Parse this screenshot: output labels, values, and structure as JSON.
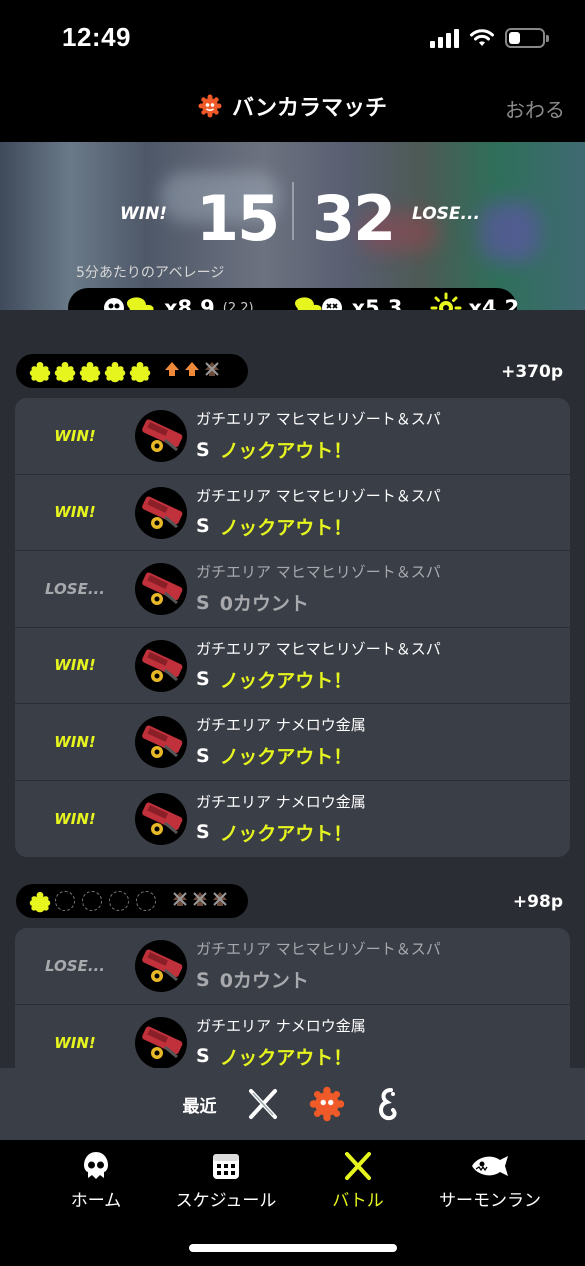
{
  "status": {
    "time": "12:49",
    "battery_level": 0.35
  },
  "header": {
    "title": "バンカラマッチ",
    "close_label": "おわる"
  },
  "summary": {
    "win_label": "WIN!",
    "win_count": "15",
    "lose_count": "32",
    "lose_label": "LOSE...",
    "average_label": "5分あたりのアベレージ",
    "kills": "x8.9",
    "assists": "(2.2)",
    "deaths": "x5.3",
    "specials": "x4.2"
  },
  "groups": [
    {
      "points": "+370p",
      "ink_filled": 5,
      "ink_empty": 0,
      "matches": [
        {
          "result": "WIN!",
          "stage": "ガチエリア マヒマヒリゾート＆スパ",
          "rank": "S",
          "outcome": "ノックアウト！"
        },
        {
          "result": "WIN!",
          "stage": "ガチエリア マヒマヒリゾート＆スパ",
          "rank": "S",
          "outcome": "ノックアウト！"
        },
        {
          "result": "LOSE...",
          "stage": "ガチエリア マヒマヒリゾート＆スパ",
          "rank": "S",
          "outcome": "0カウント"
        },
        {
          "result": "WIN!",
          "stage": "ガチエリア マヒマヒリゾート＆スパ",
          "rank": "S",
          "outcome": "ノックアウト！"
        },
        {
          "result": "WIN!",
          "stage": "ガチエリア ナメロウ金属",
          "rank": "S",
          "outcome": "ノックアウト！"
        },
        {
          "result": "WIN!",
          "stage": "ガチエリア ナメロウ金属",
          "rank": "S",
          "outcome": "ノックアウト！"
        }
      ]
    },
    {
      "points": "+98p",
      "ink_filled": 1,
      "ink_empty": 4,
      "matches": [
        {
          "result": "LOSE...",
          "stage": "ガチエリア マヒマヒリゾート＆スパ",
          "rank": "S",
          "outcome": "0カウント"
        },
        {
          "result": "WIN!",
          "stage": "ガチエリア ナメロウ金属",
          "rank": "S",
          "outcome": "ノックアウト！"
        }
      ]
    }
  ],
  "filter": {
    "label": "最近"
  },
  "tabs": [
    {
      "label": "ホーム"
    },
    {
      "label": "スケジュール"
    },
    {
      "label": "バトル"
    },
    {
      "label": "サーモンラン"
    }
  ],
  "colors": {
    "accent_yellow": "#e7f51f",
    "accent_orange": "#f05a28",
    "panel": "#3a3e47",
    "background": "#2a2d33"
  }
}
